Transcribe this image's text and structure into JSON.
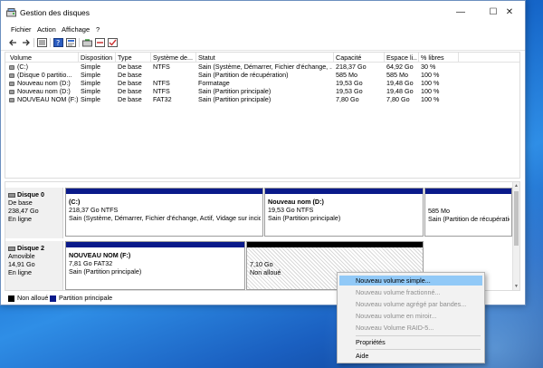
{
  "window": {
    "title": "Gestion des disques",
    "controls": {
      "minimize": "—",
      "maximize": "☐",
      "close": "✕"
    }
  },
  "menu": [
    "Fichier",
    "Action",
    "Affichage",
    "?"
  ],
  "toolbar_icons": [
    "back-arrow-icon",
    "forward-arrow-icon",
    "list-view-icon",
    "help-icon",
    "properties-icon",
    "refresh-icon",
    "settings-icon",
    "check-icon"
  ],
  "columns": [
    "Volume",
    "Disposition",
    "Type",
    "Système de...",
    "Statut",
    "Capacité",
    "Espace li...",
    "% libres"
  ],
  "volumes": [
    [
      "(C:)",
      "Simple",
      "De base",
      "NTFS",
      "Sain (Système, Démarrer, Fichier d'échange, ...",
      "218,37 Go",
      "64,92 Go",
      "30 %"
    ],
    [
      "(Disque 0 partitio...",
      "Simple",
      "De base",
      "",
      "Sain (Partition de récupération)",
      "585 Mo",
      "585 Mo",
      "100 %"
    ],
    [
      "Nouveau nom (D:)",
      "Simple",
      "De base",
      "NTFS",
      "Formatage",
      "19,53 Go",
      "19,48 Go",
      "100 %"
    ],
    [
      "Nouveau nom (D:)",
      "Simple",
      "De base",
      "NTFS",
      "Sain (Partition principale)",
      "19,53 Go",
      "19,48 Go",
      "100 %"
    ],
    [
      "NOUVEAU NOM (F:)",
      "Simple",
      "De base",
      "FAT32",
      "Sain (Partition principale)",
      "7,80 Go",
      "7,80 Go",
      "100 %"
    ]
  ],
  "disks": [
    {
      "name": "Disque 0",
      "type": "De base",
      "size": "238,47 Go",
      "status": "En ligne",
      "partitions": [
        {
          "title": "(C:)",
          "size": "218,37 Go NTFS",
          "status": "Sain (Système, Démarrer, Fichier d'échange, Actif, Vidage sur incident"
        },
        {
          "title": "Nouveau nom  (D:)",
          "size": "19,53 Go NTFS",
          "status": "Sain (Partition principale)"
        },
        {
          "title": "",
          "size": "585 Mo",
          "status": "Sain (Partition de récupération)"
        }
      ]
    },
    {
      "name": "Disque 2",
      "type": "Amovible",
      "size": "14,91 Go",
      "status": "En ligne",
      "partitions": [
        {
          "title": "NOUVEAU NOM  (F:)",
          "size": "7,81 Go FAT32",
          "status": "Sain (Partition principale)"
        },
        {
          "title": "",
          "size": "7,10 Go",
          "status": "Non alloué"
        }
      ]
    }
  ],
  "legend": [
    {
      "label": "Non alloué",
      "color": "#000000"
    },
    {
      "label": "Partition principale",
      "color": "#0a1a8a"
    }
  ],
  "context_menu": [
    {
      "label": "Nouveau volume simple...",
      "highlighted": true,
      "disabled": false
    },
    {
      "label": "Nouveau volume fractionné...",
      "highlighted": false,
      "disabled": true
    },
    {
      "label": "Nouveau volume agrégé par bandes...",
      "highlighted": false,
      "disabled": true
    },
    {
      "label": "Nouveau volume en miroir...",
      "highlighted": false,
      "disabled": true
    },
    {
      "label": "Nouveau Volume RAID-5...",
      "highlighted": false,
      "disabled": true
    },
    {
      "label": "Propriétés",
      "highlighted": false,
      "disabled": false
    },
    {
      "label": "Aide",
      "highlighted": false,
      "disabled": false
    }
  ]
}
